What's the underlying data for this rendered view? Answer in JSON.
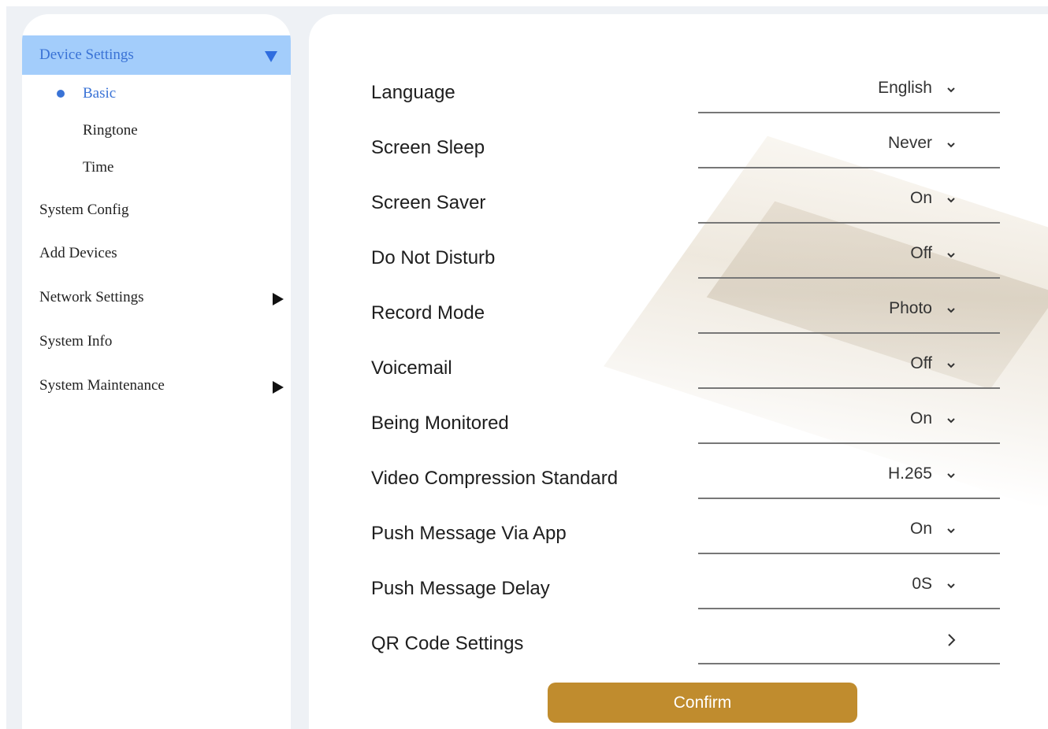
{
  "sidebar": {
    "header": "Device Settings",
    "sub_items": [
      "Basic",
      "Ringtone",
      "Time"
    ],
    "items": [
      "System Config",
      "Add Devices",
      "Network Settings",
      "System Info",
      "System Maintenance"
    ]
  },
  "settings": [
    {
      "label": "Language",
      "value": "English"
    },
    {
      "label": "Screen Sleep",
      "value": "Never"
    },
    {
      "label": "Screen Saver",
      "value": "On"
    },
    {
      "label": "Do Not Disturb",
      "value": "Off"
    },
    {
      "label": "Record Mode",
      "value": "Photo"
    },
    {
      "label": "Voicemail",
      "value": "Off"
    },
    {
      "label": "Being Monitored",
      "value": "On"
    },
    {
      "label": "Video Compression Standard",
      "value": "H.265"
    },
    {
      "label": "Push Message Via App",
      "value": "On"
    },
    {
      "label": "Push Message Delay",
      "value": "0S"
    },
    {
      "label": "QR Code Settings",
      "value": ""
    }
  ],
  "confirm_label": "Confirm",
  "colors": {
    "accent_blue": "#3a73d6",
    "header_bg": "#a3cdfb",
    "confirm_bg": "#c08c2e"
  },
  "icons": {
    "dropdown": "chevron-down-icon",
    "expand": "triangle-down-icon",
    "collapsed": "triangle-right-icon",
    "link": "chevron-right-icon"
  }
}
